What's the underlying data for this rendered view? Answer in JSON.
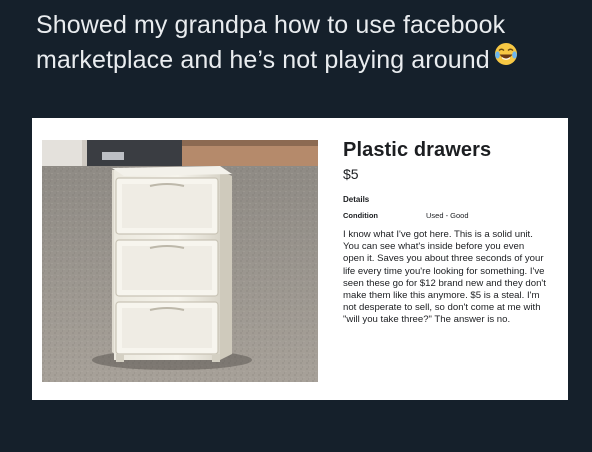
{
  "caption": {
    "text": "Showed my grandpa how to use facebook marketplace and he’s not playing around",
    "emoji_icon": "laughing-with-tears-emoji"
  },
  "listing": {
    "title": "Plastic drawers",
    "price": "$5",
    "details_label": "Details",
    "condition_label": "Condition",
    "condition_value": "Used - Good",
    "description": "I know what I've got here. This is a solid unit. You can see what's inside before you even open it. Saves you about three seconds of your life every time you're looking for something. I've seen these go for $12 brand new and they don't make them like this anymore. $5 is a steal. I'm not desperate to sell, so don't come at me with \"will you take three?\" The answer is no."
  },
  "colors": {
    "background": "#15202b",
    "caption_text": "#e9ecef",
    "card": "#ffffff",
    "text": "#1c1e21"
  }
}
